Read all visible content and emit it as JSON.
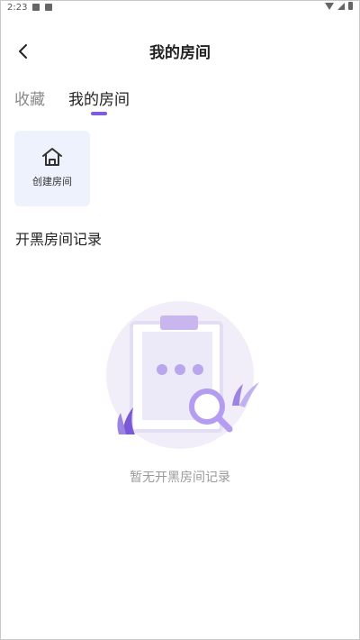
{
  "status_bar": {
    "time": "2:23"
  },
  "header": {
    "title": "我的房间"
  },
  "tabs": [
    {
      "label": "收藏",
      "active": false
    },
    {
      "label": "我的房间",
      "active": true
    }
  ],
  "create_room": {
    "label": "创建房间"
  },
  "section": {
    "title": "开黑房间记录"
  },
  "empty_state": {
    "message": "暂无开黑房间记录"
  },
  "colors": {
    "accent": "#7c5ce0",
    "card_bg": "#eef2fc"
  }
}
